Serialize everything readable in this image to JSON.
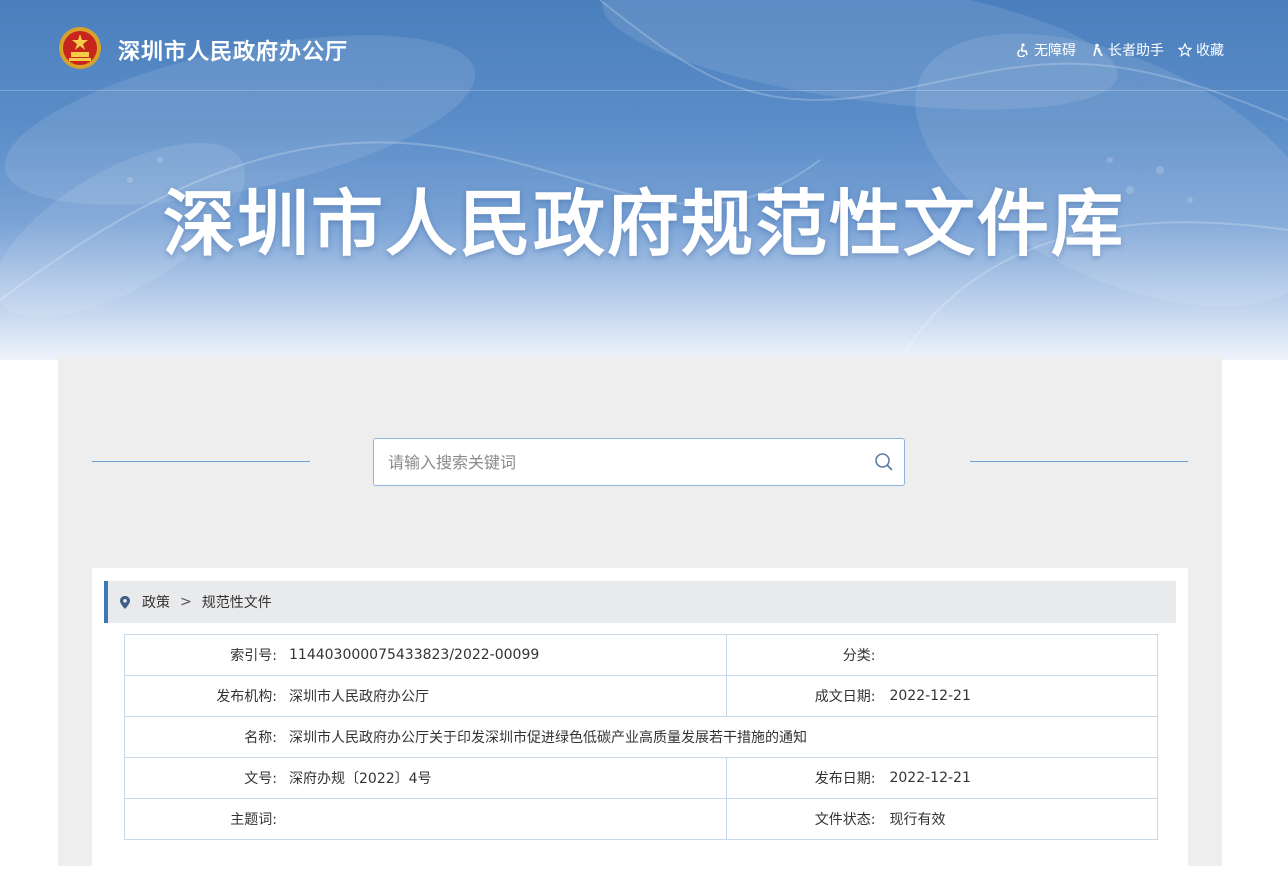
{
  "header": {
    "org_name": "深圳市人民政府办公厅",
    "title": "深圳市人民政府规范性文件库",
    "links": [
      {
        "label": "无障碍",
        "icon": "accessibility-icon"
      },
      {
        "label": "长者助手",
        "icon": "elder-assistant-icon"
      },
      {
        "label": "收藏",
        "icon": "star-icon"
      }
    ]
  },
  "search": {
    "placeholder": "请输入搜索关键词",
    "icon": "search-icon"
  },
  "breadcrumb": {
    "icon": "location-pin-icon",
    "items": [
      "政策",
      "规范性文件"
    ],
    "separator": ">"
  },
  "info": {
    "index_no": {
      "label": "索引号:",
      "value": "11440300007543382З/2022-00099"
    },
    "category": {
      "label": "分类:",
      "value": ""
    },
    "publisher": {
      "label": "发布机构:",
      "value": "深圳市人民政府办公厅"
    },
    "written_date": {
      "label": "成文日期:",
      "value": "2022-12-21"
    },
    "name": {
      "label": "名称:",
      "value": "深圳市人民政府办公厅关于印发深圳市促进绿色低碳产业高质量发展若干措施的通知"
    },
    "doc_no": {
      "label": "文号:",
      "value": "深府办规〔2022〕4号"
    },
    "publish_date": {
      "label": "发布日期:",
      "value": "2022-12-21"
    },
    "keywords": {
      "label": "主题词:",
      "value": ""
    },
    "status": {
      "label": "文件状态:",
      "value": "现行有效"
    }
  },
  "colors": {
    "banner_top": "#4a7fbd",
    "accent": "#3f76b4",
    "panel_bg": "#eeeeee",
    "table_border": "#c8d8ea"
  }
}
